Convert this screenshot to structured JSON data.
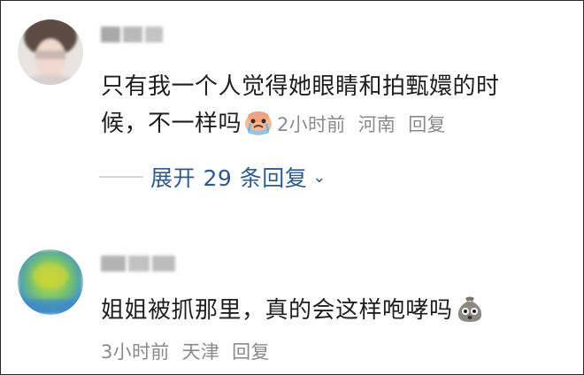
{
  "comments": [
    {
      "avatar_icon": "blurred-face-avatar",
      "text_line1": "只有我一个人觉得她眼睛和拍甄嬛的时",
      "text_line2": "候，不一样吗",
      "emoji_icon": "crying-face-emoji",
      "time": "2小时前",
      "location": "河南",
      "reply_label": "回复",
      "expand_label": "展开 29 条回复"
    },
    {
      "avatar_icon": "blurred-green-avatar",
      "text_line1": "姐姐被抓那里，真的会这样咆哮吗",
      "emoji_icon": "sack-face-emoji",
      "time": "3小时前",
      "location": "天津",
      "reply_label": "回复"
    }
  ]
}
